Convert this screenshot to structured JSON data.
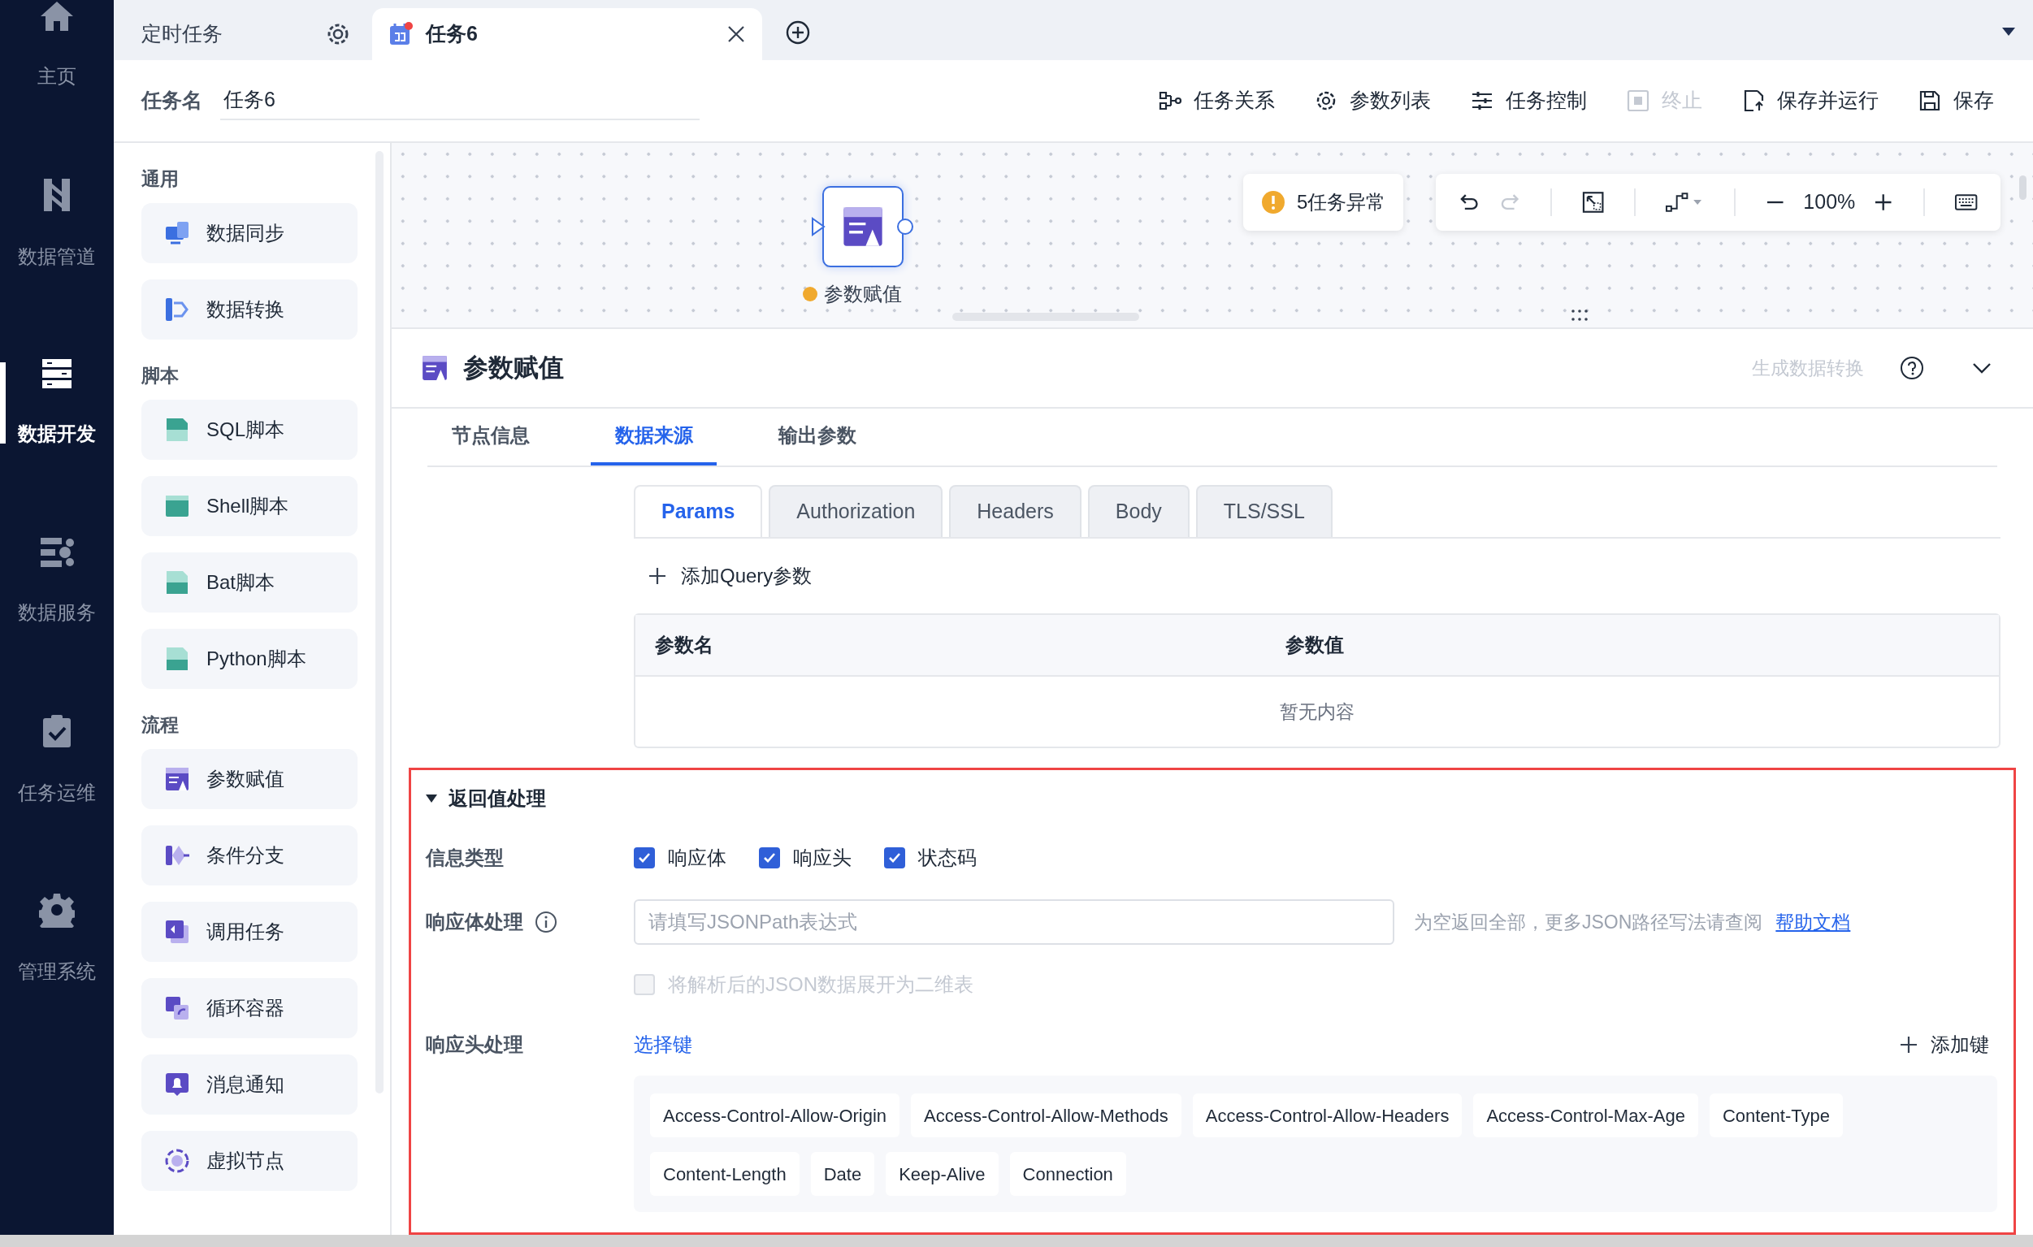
{
  "nav": [
    {
      "label": "主页",
      "selected": false
    },
    {
      "label": "数据管道",
      "selected": false
    },
    {
      "label": "数据开发",
      "selected": true
    },
    {
      "label": "数据服务",
      "selected": false
    },
    {
      "label": "任务运维",
      "selected": false
    },
    {
      "label": "管理系统",
      "selected": false
    }
  ],
  "tabs": [
    {
      "label": "定时任务",
      "selected": false
    },
    {
      "label": "任务6",
      "selected": true
    }
  ],
  "task_name": {
    "label": "任务名",
    "value": "任务6"
  },
  "toolbar": [
    {
      "label": "任务关系",
      "disabled": false
    },
    {
      "label": "参数列表",
      "disabled": false
    },
    {
      "label": "任务控制",
      "disabled": false
    },
    {
      "label": "终止",
      "disabled": true
    },
    {
      "label": "保存并运行",
      "disabled": false
    },
    {
      "label": "保存",
      "disabled": false
    }
  ],
  "palette": [
    {
      "title": "通用",
      "items": [
        "数据同步",
        "数据转换"
      ]
    },
    {
      "title": "脚本",
      "items": [
        "SQL脚本",
        "Shell脚本",
        "Bat脚本",
        "Python脚本"
      ]
    },
    {
      "title": "流程",
      "items": [
        "参数赋值",
        "条件分支",
        "调用任务",
        "循环容器",
        "消息通知",
        "虚拟节点"
      ]
    }
  ],
  "canvas": {
    "node": {
      "label": "参数赋值",
      "warning": true
    },
    "alert": "5任务异常",
    "zoom": "100%"
  },
  "panel": {
    "title": "参数赋值",
    "generate_link": "生成数据转换",
    "tabs": [
      {
        "label": "节点信息",
        "selected": false
      },
      {
        "label": "数据来源",
        "selected": true
      },
      {
        "label": "输出参数",
        "selected": false
      }
    ],
    "request_tabs": [
      {
        "label": "Params",
        "selected": true
      },
      {
        "label": "Authorization",
        "selected": false
      },
      {
        "label": "Headers",
        "selected": false
      },
      {
        "label": "Body",
        "selected": false
      },
      {
        "label": "TLS/SSL",
        "selected": false
      }
    ],
    "add_query": "添加Query参数",
    "table": {
      "columns": [
        "参数名",
        "参数值"
      ],
      "empty": "暂无内容"
    }
  },
  "response": {
    "title": "返回值处理",
    "expanded": true,
    "highlighted": true,
    "info_type": {
      "label": "信息类型",
      "options": [
        {
          "label": "响应体",
          "checked": true
        },
        {
          "label": "响应头",
          "checked": true
        },
        {
          "label": "状态码",
          "checked": true
        }
      ]
    },
    "body": {
      "label": "响应体处理",
      "placeholder": "请填写JSONPath表达式",
      "hint": "为空返回全部，更多JSON路径写法请查阅",
      "link": "帮助文档",
      "flatten": {
        "label": "将解析后的JSON数据展开为二维表",
        "checked": false,
        "disabled": true
      }
    },
    "headers": {
      "label": "响应头处理",
      "select_link": "选择键",
      "add": "添加键",
      "keys": [
        "Access-Control-Allow-Origin",
        "Access-Control-Allow-Methods",
        "Access-Control-Allow-Headers",
        "Access-Control-Max-Age",
        "Content-Type",
        "Content-Length",
        "Date",
        "Keep-Alive",
        "Connection"
      ]
    }
  }
}
